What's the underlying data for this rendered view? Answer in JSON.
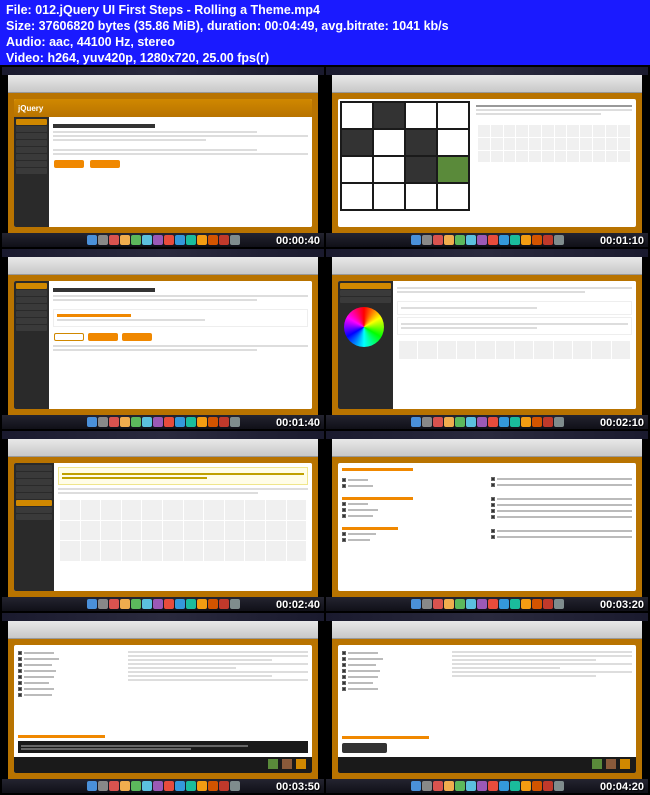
{
  "header": {
    "file_label": "File:",
    "file_name": "012.jQuery UI First Steps - Rolling a Theme.mp4",
    "size_label": "Size:",
    "size_value": "37606820 bytes (35.86 MiB), duration: 00:04:49, avg.bitrate: 1041 kb/s",
    "audio_label": "Audio:",
    "audio_value": "aac, 44100 Hz, stereo",
    "video_label": "Video:",
    "video_value": "h264, yuv420p, 1280x720, 25.00 fps(r)"
  },
  "thumbnails": [
    {
      "timestamp": "00:00:40",
      "type": "themeroller-main",
      "title": "ThemeRoller",
      "logo": "jQuery"
    },
    {
      "timestamp": "00:01:10",
      "type": "gallery"
    },
    {
      "timestamp": "00:01:40",
      "type": "themeroller-tabs",
      "title": "ThemeRoller"
    },
    {
      "timestamp": "00:02:10",
      "type": "color-picker"
    },
    {
      "timestamp": "00:02:40",
      "type": "icons-expanded"
    },
    {
      "timestamp": "00:03:20",
      "type": "download-builder"
    },
    {
      "timestamp": "00:03:50",
      "type": "download-options"
    },
    {
      "timestamp": "00:04:20",
      "type": "download-final"
    }
  ],
  "dock_colors": [
    "#4a90d9",
    "#888",
    "#d9534f",
    "#f0ad4e",
    "#5cb85c",
    "#5bc0de",
    "#9b59b6",
    "#e74c3c",
    "#3498db",
    "#1abc9c",
    "#f39c12",
    "#d35400",
    "#c0392b",
    "#7f8c8d"
  ],
  "footer_colors": [
    "#5a8a3a",
    "#8a5a3a",
    "#d08800"
  ]
}
